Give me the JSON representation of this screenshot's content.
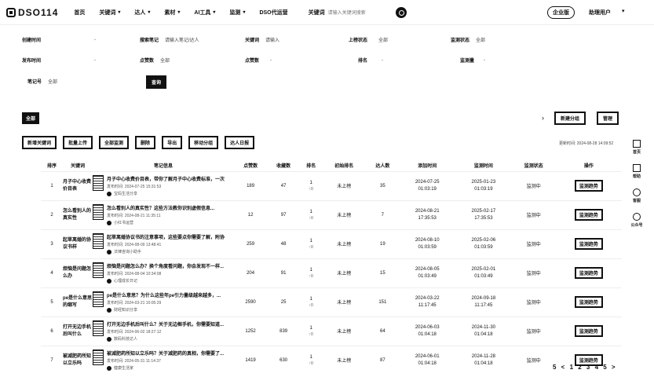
{
  "header": {
    "logo": "DSO114",
    "nav": [
      {
        "label": "首页",
        "chev": ""
      },
      {
        "label": "关键词",
        "chev": "▾"
      },
      {
        "label": "达人",
        "chev": "▾"
      },
      {
        "label": "素材",
        "chev": "▾"
      },
      {
        "label": "AI工具",
        "chev": "▾"
      },
      {
        "label": "监测",
        "chev": "▾"
      },
      {
        "label": "DSO代运营",
        "chev": ""
      }
    ],
    "search_label": "关键词",
    "search_placeholder": "请输入关键词搜索",
    "enterprise": "企业版",
    "user": "助理用户",
    "user_chev": "▾"
  },
  "filters": {
    "row1": [
      {
        "label": "创建时间",
        "value": "-"
      },
      {
        "label": "搜索笔记",
        "value": "请输入笔记/达人"
      },
      {
        "label": "关键词",
        "value": "请输入"
      },
      {
        "label": "上榜状态",
        "value": "全部"
      },
      {
        "label": "监测状态",
        "value": "全部"
      }
    ],
    "row2": [
      {
        "label": "发布时间",
        "value": "-"
      },
      {
        "label": "点赞数",
        "value": "全部"
      },
      {
        "label": "点赞数",
        "value": "- "
      },
      {
        "label": "排名",
        "value": "-"
      },
      {
        "label": "监测量",
        "value": "-"
      }
    ],
    "row3": [
      {
        "label": "笔记号",
        "value": "全部"
      }
    ],
    "query_btn": "查询"
  },
  "tabs": {
    "all": "全部",
    "add_category": "新建分组",
    "manage": "管理"
  },
  "toolbar": [
    "新增关键词",
    "批量上传",
    "全部监测",
    "删除",
    "导出",
    "移动分组",
    "达人日报"
  ],
  "update_time": "更新时间: 2024-08-28 14:09:52",
  "table": {
    "headers": [
      "排序",
      "关键词",
      "笔记信息",
      "点赞数",
      "收藏数",
      "排名",
      "初始排名",
      "达人数",
      "添加时间",
      "监测时间",
      "监测状态",
      "操作"
    ],
    "rows": [
      {
        "idx": "1",
        "kw": "月子中心收费价目表",
        "title": "月子中心收费价目表，带你了解月子中心收费标准，一次...",
        "time": "发布时间: 2024-07-25 15:31:53",
        "author": "宝妈生活分享",
        "likes": "189",
        "favs": "47",
        "rank": "1",
        "rank_sub": "↑0",
        "init": "未上榜",
        "count": "35",
        "add_date": "2024-07-25",
        "add_time": "01:03:19",
        "mon_date": "2025-01-23",
        "mon_time": "01:03:19",
        "status": "监测中",
        "op": "监测趋势"
      },
      {
        "idx": "2",
        "kw": "怎么看别人的真实性",
        "title": "怎么看别人的真实性？这些方法教你识别虚假信息...",
        "time": "发布时间: 2024-08-21 11:35:11",
        "author": "小红书运营",
        "likes": "12",
        "favs": "97",
        "rank": "1",
        "rank_sub": "↑0",
        "init": "未上榜",
        "count": "7",
        "add_date": "2024-08-21",
        "add_time": "17:35:53",
        "mon_date": "2025-02-17",
        "mon_time": "17:35:53",
        "status": "监测中",
        "op": "监测趋势"
      },
      {
        "idx": "3",
        "kw": "起草离婚的协议书样",
        "title": "起草离婚协议书的注意事项，这些要点你需要了解，附协...",
        "time": "发布时间: 2024-08-09 13:48:41",
        "author": "法律咨询小助手",
        "likes": "259",
        "favs": "48",
        "rank": "1",
        "rank_sub": "↑0",
        "init": "未上榜",
        "count": "19",
        "add_date": "2024-08-10",
        "add_time": "01:03:59",
        "mon_date": "2025-02-06",
        "mon_time": "01:03:59",
        "status": "监测中",
        "op": "监测趋势"
      },
      {
        "idx": "4",
        "kw": "烦恼是问题怎么办",
        "title": "烦恼是问题怎么办？换个角度看问题，你会发现不一样...",
        "time": "发布时间: 2024-08-04 10:34:08",
        "author": "心理成长日记",
        "likes": "204",
        "favs": "91",
        "rank": "1",
        "rank_sub": "↑0",
        "init": "未上榜",
        "count": "15",
        "add_date": "2024-08-05",
        "add_time": "01:03:49",
        "mon_date": "2025-02-01",
        "mon_time": "01:03:49",
        "status": "监测中",
        "op": "监测趋势"
      },
      {
        "idx": "5",
        "kw": "pe是什么意思的缩写",
        "title": "pe是什么意思？为什么这些年pe引力量级越来越多，...",
        "time": "发布时间: 2024-03-21 10:05:29",
        "author": "财经知识分享",
        "likes": "2590",
        "favs": "25",
        "rank": "1",
        "rank_sub": "↑0",
        "init": "未上榜",
        "count": "151",
        "add_date": "2024-03-22",
        "add_time": "11:17:45",
        "mon_date": "2024-09-18",
        "mon_time": "11:17:45",
        "status": "监测中",
        "op": "监测趋势"
      },
      {
        "idx": "6",
        "kw": "打开无边手机后叫什么",
        "title": "打开无边手机后叫什么？关于无边框手机，你需要知道...",
        "time": "发布时间: 2024-06-02 18:27:12",
        "author": "数码科技达人",
        "likes": "1252",
        "favs": "839",
        "rank": "1",
        "rank_sub": "↑0",
        "init": "未上榜",
        "count": "64",
        "add_date": "2024-06-03",
        "add_time": "01:04:18",
        "mon_date": "2024-11-30",
        "mon_time": "01:04:18",
        "status": "监测中",
        "op": "监测趋势"
      },
      {
        "idx": "7",
        "kw": "被减肥药所知以立乐吗",
        "title": "被减肥药所知以立乐吗？关于减肥药的真相，你需要了...",
        "time": "发布时间: 2024-05-31 11:14:37",
        "author": "健康生活家",
        "likes": "1419",
        "favs": "630",
        "rank": "1",
        "rank_sub": "↑0",
        "init": "未上榜",
        "count": "87",
        "add_date": "2024-06-01",
        "add_time": "01:04:18",
        "mon_date": "2024-11-28",
        "mon_time": "01:04:18",
        "status": "监测中",
        "op": "监测趋势"
      }
    ]
  },
  "sidebar": [
    {
      "icon": "cube-icon",
      "label": "首页"
    },
    {
      "icon": "book-icon",
      "label": "帮助"
    },
    {
      "icon": "clock-icon",
      "label": "客服"
    },
    {
      "icon": "link-icon",
      "label": "公众号"
    }
  ],
  "pager": "5 < 1 2 3 4 5 >"
}
